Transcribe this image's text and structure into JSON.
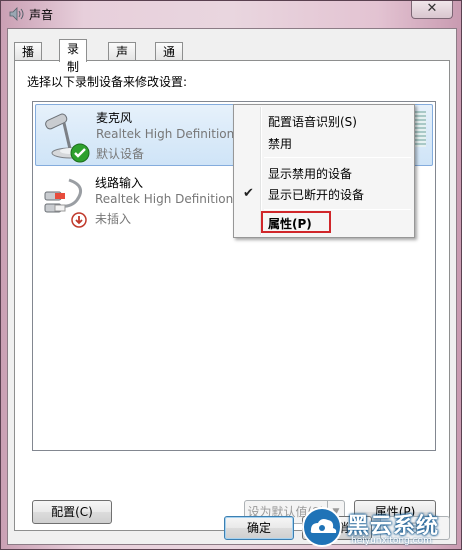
{
  "window": {
    "title": "声音",
    "close_glyph": "✕"
  },
  "tabs": [
    {
      "label": "播放"
    },
    {
      "label": "录制"
    },
    {
      "label": "声音"
    },
    {
      "label": "通信"
    }
  ],
  "instruction": "选择以下录制设备来修改设置:",
  "devices": [
    {
      "name": "麦克风",
      "description": "Realtek High Definition Au",
      "status": "默认设备",
      "icon": "microphone-icon",
      "badge": "check-badge-icon"
    },
    {
      "name": "线路输入",
      "description": "Realtek High Definition Audio",
      "status": "未插入",
      "icon": "line-in-cable-icon",
      "badge": "unplugged-badge-icon"
    }
  ],
  "context_menu": {
    "items": [
      {
        "label": "配置语音识别(S)"
      },
      {
        "label": "禁用"
      },
      {
        "label": "显示禁用的设备"
      },
      {
        "label": "显示已断开的设备",
        "checked": true
      },
      {
        "label": "属性(P)",
        "bold": true,
        "highlighted": true
      }
    ],
    "check_glyph": "✔"
  },
  "buttons": {
    "configure": "配置(C)",
    "set_default": "设为默认值(S)",
    "set_default_arrow": "▼",
    "properties": "属性(P)",
    "ok": "确定",
    "cancel": "取消",
    "apply": "应用(A)"
  },
  "watermark": {
    "text": "黑云系统",
    "url": "heiyunxitong.com"
  },
  "colors": {
    "highlight_border": "#d0262a",
    "selection": "#cfe4f7",
    "check_green": "#2ea12e"
  }
}
